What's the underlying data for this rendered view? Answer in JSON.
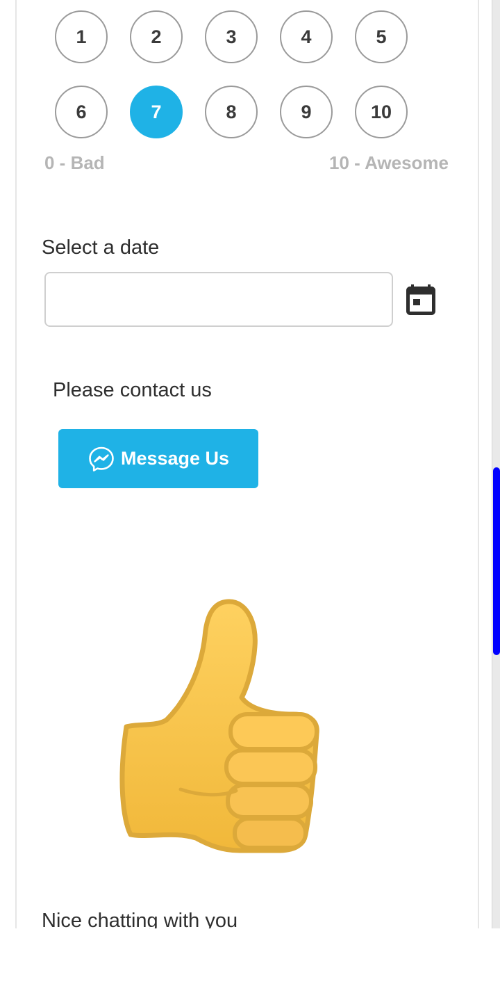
{
  "rating": {
    "options": [
      "1",
      "2",
      "3",
      "4",
      "5",
      "6",
      "7",
      "8",
      "9",
      "10"
    ],
    "selected": "7",
    "low_label": "0 - Bad",
    "high_label": "10 - Awesome"
  },
  "date_field": {
    "label": "Select a date",
    "value": "",
    "placeholder": "",
    "icon": "calendar-icon"
  },
  "contact": {
    "text": "Please contact us",
    "button_label": "Message Us",
    "button_icon": "messenger-icon"
  },
  "image": {
    "icon": "thumbs-up-icon"
  },
  "closing_message": "Nice chatting with you",
  "colors": {
    "accent": "#1fb2e6",
    "scrollbar": "#0000ff"
  }
}
